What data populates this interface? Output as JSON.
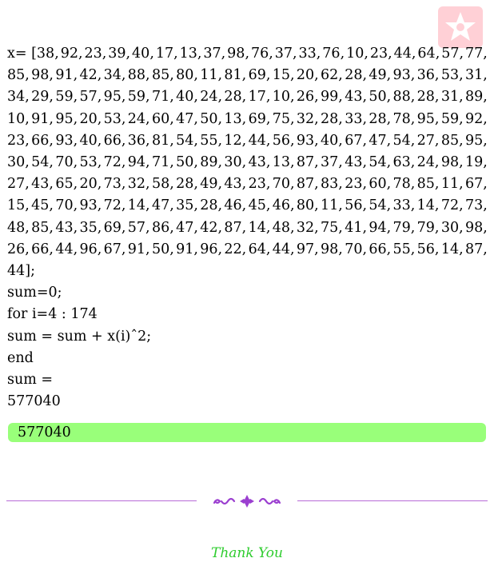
{
  "code": {
    "array_lines": [
      [
        "x= [38,",
        "92,",
        "23,",
        "39,",
        "40,",
        "17,",
        "13,",
        "37,",
        "98,",
        "76,",
        "37,",
        "33,",
        "76,",
        "10,",
        "23,",
        "44,",
        "64,",
        "57,",
        "77,"
      ],
      [
        "85,",
        "98,",
        "91,",
        "42,",
        "34,",
        "88,",
        "85,",
        "80,",
        "11,",
        "81,",
        "69,",
        "15,",
        "20,",
        "62,",
        "28,",
        "49,",
        "93,",
        "36,",
        "53,",
        "31,"
      ],
      [
        "34,",
        "29,",
        "59,",
        "57,",
        "95,",
        "59,",
        "71,",
        "40,",
        "24,",
        "28,",
        "17,",
        "10,",
        "26,",
        "99,",
        "43,",
        "50,",
        "88,",
        "28,",
        "31,",
        "89,"
      ],
      [
        "10,",
        "91,",
        "95,",
        "20,",
        "53,",
        "24,",
        "60,",
        "47,",
        "50,",
        "13,",
        "69,",
        "75,",
        "32,",
        "28,",
        "33,",
        "28,",
        "78,",
        "95,",
        "59,",
        "92,"
      ],
      [
        "23,",
        "66,",
        "93,",
        "40,",
        "66,",
        "36,",
        "81,",
        "54,",
        "55,",
        "12,",
        "44,",
        "56,",
        "93,",
        "40,",
        "67,",
        "47,",
        "54,",
        "27,",
        "85,",
        "95,"
      ],
      [
        "30,",
        "54,",
        "70,",
        "53,",
        "72,",
        "94,",
        "71,",
        "50,",
        "89,",
        "30,",
        "43,",
        "13,",
        "87,",
        "37,",
        "43,",
        "54,",
        "63,",
        "24,",
        "98,",
        "19,"
      ],
      [
        "27,",
        "43,",
        "65,",
        "20,",
        "73,",
        "32,",
        "58,",
        "28,",
        "49,",
        "43,",
        "23,",
        "70,",
        "87,",
        "83,",
        "23,",
        "60,",
        "78,",
        "85,",
        "11,",
        "67,"
      ],
      [
        "15,",
        "45,",
        "70,",
        "93,",
        "72,",
        "14,",
        "47,",
        "35,",
        "28,",
        "46,",
        "45,",
        "46,",
        "80,",
        "11,",
        "56,",
        "54,",
        "33,",
        "14,",
        "72,",
        "73,"
      ],
      [
        "48,",
        "85,",
        "43,",
        "35,",
        "69,",
        "57,",
        "86,",
        "47,",
        "42,",
        "87,",
        "14,",
        "48,",
        "32,",
        "75,",
        "41,",
        "94,",
        "79,",
        "79,",
        "30,",
        "98,"
      ],
      [
        "26,",
        "66,",
        "44,",
        "96,",
        "67,",
        "91,",
        "50,",
        "91,",
        "96,",
        "22,",
        "64,",
        "44,",
        "97,",
        "98,",
        "70,",
        "66,",
        "55,",
        "56,",
        "14,",
        "87,"
      ]
    ],
    "array_end": "44];",
    "lines": [
      "sum=0;",
      "for i=4 : 174",
      "sum = sum + x(i)ˆ2;",
      "end",
      "sum =",
      "577040"
    ]
  },
  "result": "577040",
  "footer": "Thank You",
  "colors": {
    "result_bg": "#99ff7a",
    "rule": "#b86bd8",
    "ornament": "#9b3fd0",
    "thanks": "#2ecc2e",
    "logo": "#ff5a6e"
  }
}
